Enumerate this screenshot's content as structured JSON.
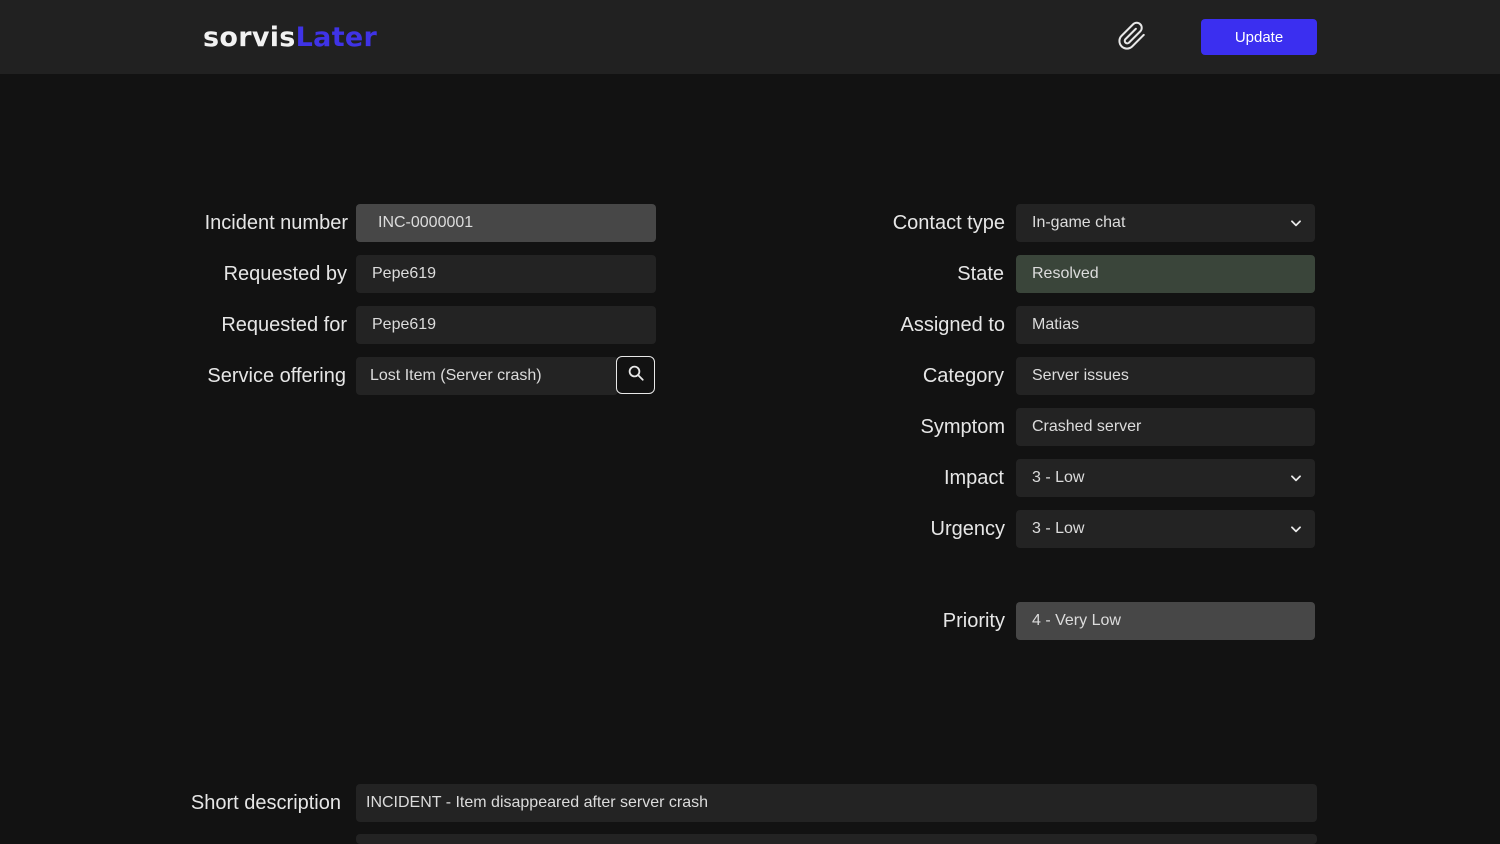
{
  "header": {
    "logo_part1": "sorvis",
    "logo_part2": "Later",
    "attach_icon": "paperclip-icon",
    "update_label": "Update"
  },
  "left": {
    "incident_number": {
      "label": "Incident number",
      "value": "INC-0000001"
    },
    "requested_by": {
      "label": "Requested by",
      "value": "Pepe619"
    },
    "requested_for": {
      "label": "Requested for",
      "value": "Pepe619"
    },
    "service_offering": {
      "label": "Service offering",
      "value": "Lost Item (Server crash)",
      "search_icon": "search-icon"
    }
  },
  "right": {
    "contact_type": {
      "label": "Contact type",
      "value": "In-game chat"
    },
    "state": {
      "label": "State",
      "value": "Resolved"
    },
    "assigned_to": {
      "label": "Assigned to",
      "value": "Matias"
    },
    "category": {
      "label": "Category",
      "value": "Server issues"
    },
    "symptom": {
      "label": "Symptom",
      "value": "Crashed server"
    },
    "impact": {
      "label": "Impact",
      "value": "3 - Low"
    },
    "urgency": {
      "label": "Urgency",
      "value": "3 - Low"
    },
    "priority": {
      "label": "Priority",
      "value": "4 - Very Low"
    }
  },
  "bottom": {
    "short_description": {
      "label": "Short description",
      "value": "INCIDENT - Item disappeared after server crash"
    }
  },
  "colors": {
    "accent": "#3b2ff0",
    "logo_accent": "#3f33e6",
    "background": "#121212",
    "header_bg": "#212121",
    "resolved_bg": "#3a453a"
  }
}
